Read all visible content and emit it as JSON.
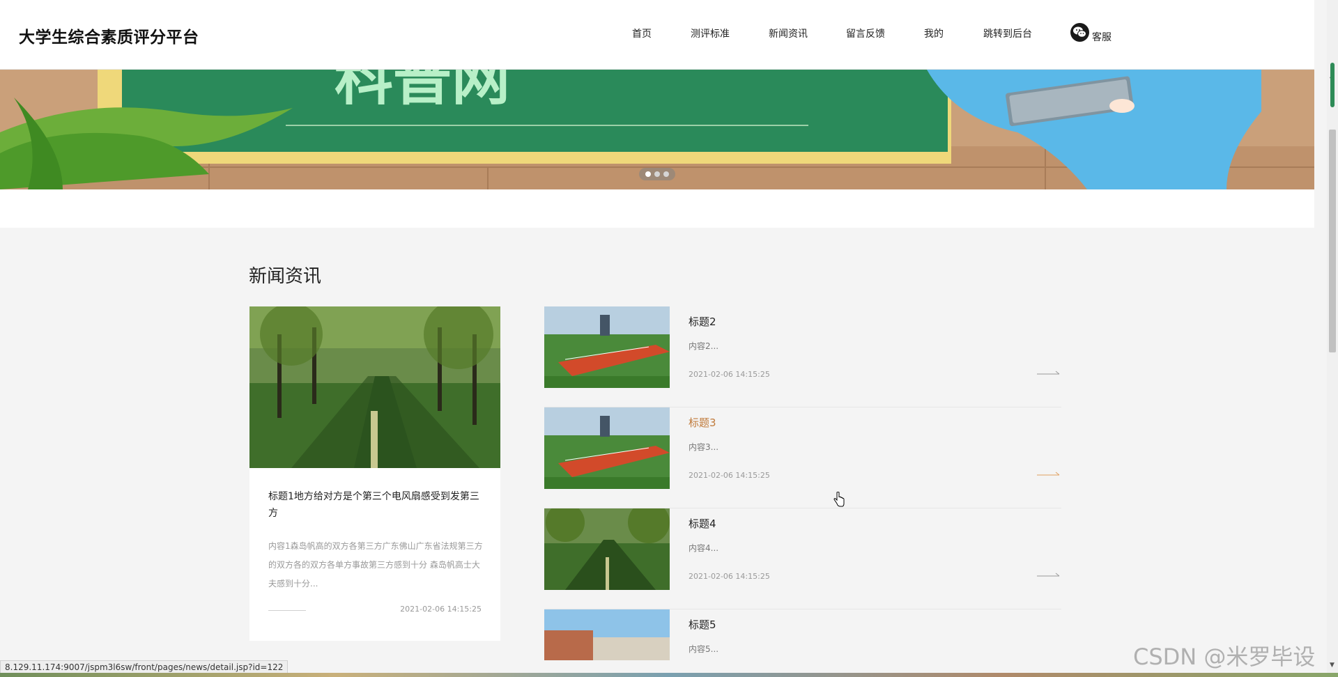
{
  "header": {
    "logo": "大学生综合素质评分平台",
    "nav": [
      "首页",
      "测评标准",
      "新闻资讯",
      "留言反馈",
      "我的",
      "跳转到后台"
    ],
    "service_label": "客服",
    "service_icon": "wechat-icon"
  },
  "banner": {
    "text": "科普网",
    "dots": 3,
    "active_dot": 1
  },
  "news": {
    "section_title": "新闻资讯",
    "featured": {
      "title": "标题1地方给对方是个第三个电风扇感受到发第三方",
      "desc": "内容1森岛帆高的双方各第三方广东佛山广东省法规第三方的双方各的双方各单方事故第三方感到十分 森岛帆高士大夫感到十分...",
      "time": "2021-02-06 14:15:25"
    },
    "items": [
      {
        "title": "标题2",
        "desc": "内容2...",
        "time": "2021-02-06 14:15:25"
      },
      {
        "title": "标题3",
        "desc": "内容3...",
        "time": "2021-02-06 14:15:25"
      },
      {
        "title": "标题4",
        "desc": "内容4...",
        "time": "2021-02-06 14:15:25"
      },
      {
        "title": "标题5",
        "desc": "内容5...",
        "time": ""
      }
    ]
  },
  "status_url": "8.129.11.174:9007/jspm3l6sw/front/pages/news/detail.jsp?id=122",
  "watermark": "CSDN @米罗毕设",
  "colors": {
    "accent": "#c07a3a",
    "banner_board": "#2a8a5a",
    "background": "#f4f4f4"
  }
}
